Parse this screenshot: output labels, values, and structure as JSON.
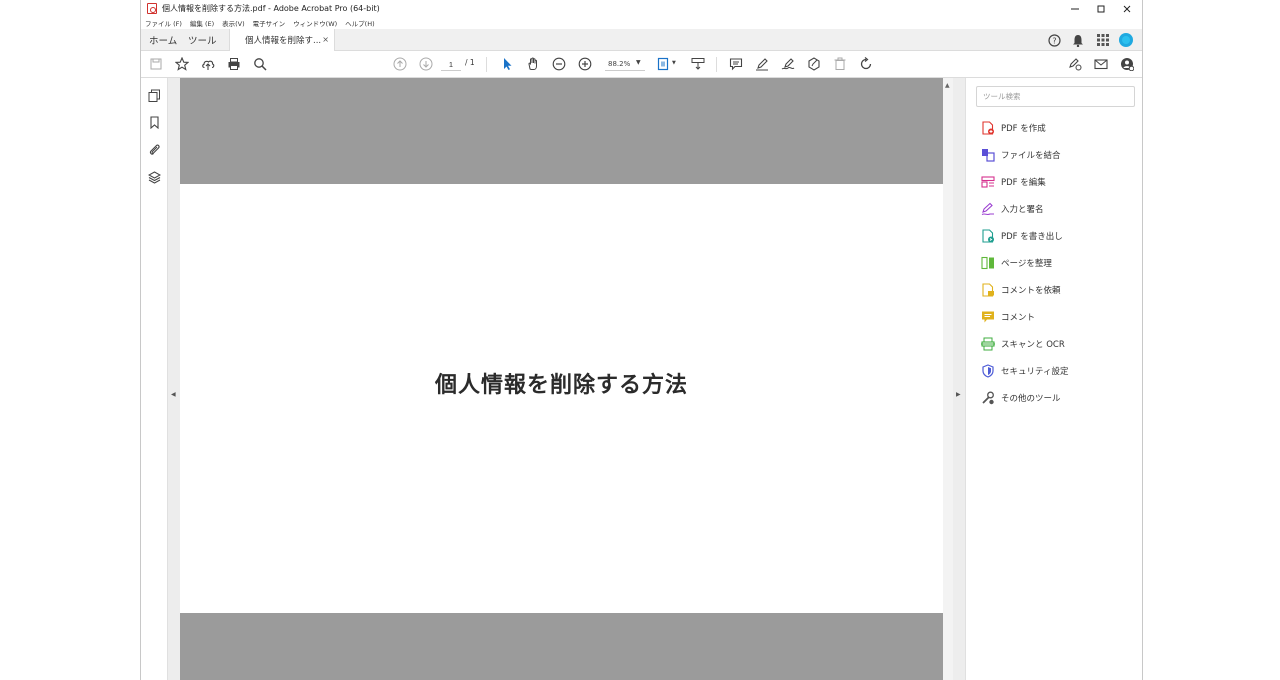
{
  "window": {
    "title": "個人情報を削除する方法.pdf - Adobe Acrobat Pro (64-bit)"
  },
  "menu": [
    "ファイル (F)",
    "編集 (E)",
    "表示(V)",
    "電子サイン",
    "ウィンドウ(W)",
    "ヘルプ(H)"
  ],
  "tabs": {
    "home": "ホーム",
    "tools": "ツール",
    "document": "個人情報を削除す...",
    "close": "×"
  },
  "toolbar": {
    "page_current": "1",
    "page_total": "/ 1",
    "zoom": "88.2%"
  },
  "document": {
    "title": "個人情報を削除する方法"
  },
  "tools_pane": {
    "search_placeholder": "ツール検索",
    "items": [
      {
        "label": "PDF を作成",
        "icon": "create-pdf-icon",
        "color": "#e0352e"
      },
      {
        "label": "ファイルを結合",
        "icon": "combine-files-icon",
        "color": "#5a4fd6"
      },
      {
        "label": "PDF を編集",
        "icon": "edit-pdf-icon",
        "color": "#d6308e"
      },
      {
        "label": "入力と署名",
        "icon": "fill-sign-icon",
        "color": "#9b3fd1"
      },
      {
        "label": "PDF を書き出し",
        "icon": "export-pdf-icon",
        "color": "#1e9e8f"
      },
      {
        "label": "ページを整理",
        "icon": "organize-pages-icon",
        "color": "#5fb83a"
      },
      {
        "label": "コメントを依頼",
        "icon": "request-comments-icon",
        "color": "#e0b21c"
      },
      {
        "label": "コメント",
        "icon": "comment-icon",
        "color": "#e0b21c"
      },
      {
        "label": "スキャンと OCR",
        "icon": "scan-ocr-icon",
        "color": "#3fae3f"
      },
      {
        "label": "セキュリティ設定",
        "icon": "security-icon",
        "color": "#4d5bd6"
      },
      {
        "label": "その他のツール",
        "icon": "more-tools-icon",
        "color": "#555555"
      }
    ]
  }
}
